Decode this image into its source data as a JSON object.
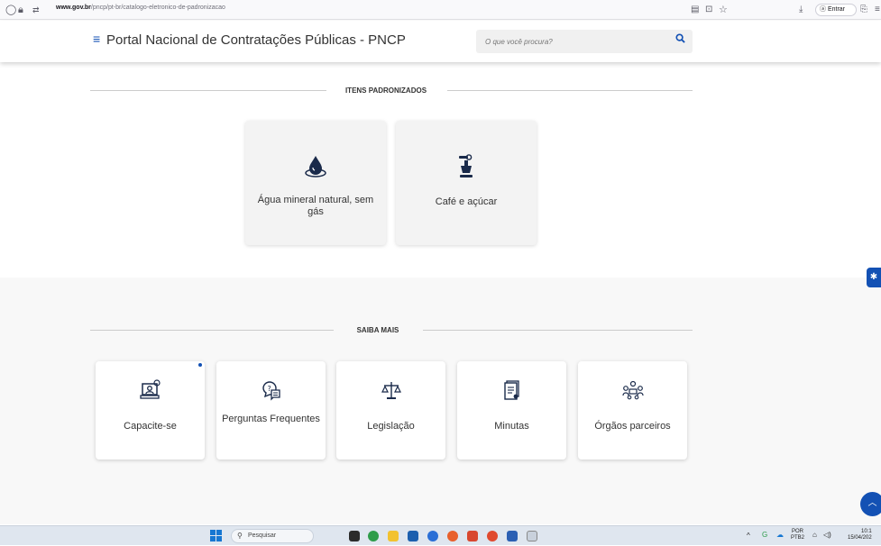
{
  "browser": {
    "url_host": "www.gov.br",
    "url_path": "/pncp/pt-br/catalogo-eletronico-de-padronizacao",
    "signin_label": "Entrar"
  },
  "header": {
    "title": "Portal Nacional de Contratações Públicas - PNCP",
    "search_placeholder": "O que você procura?"
  },
  "itens": {
    "title": "ITENS PADRONIZADOS",
    "cards": [
      {
        "label": "Água mineral natural, sem gás",
        "icon": "water-drop-icon"
      },
      {
        "label": "Café e açúcar",
        "icon": "coffee-grinder-icon"
      }
    ]
  },
  "saiba": {
    "title": "SAIBA MAIS",
    "cards": [
      {
        "label": "Capacite-se",
        "icon": "training-icon"
      },
      {
        "label": "Perguntas Frequentes",
        "icon": "faq-icon"
      },
      {
        "label": "Legislação",
        "icon": "scales-icon"
      },
      {
        "label": "Minutas",
        "icon": "document-icon"
      },
      {
        "label": "Órgãos parceiros",
        "icon": "partners-icon"
      }
    ]
  },
  "taskbar": {
    "search_label": "Pesquisar",
    "lang": "POR",
    "lang2": "PTB2",
    "time": "10:1",
    "date": "15/04/202"
  },
  "colors": {
    "accent": "#1351b4",
    "section_bg": "#f8f8f8",
    "card_bg": "#f3f3f3"
  }
}
